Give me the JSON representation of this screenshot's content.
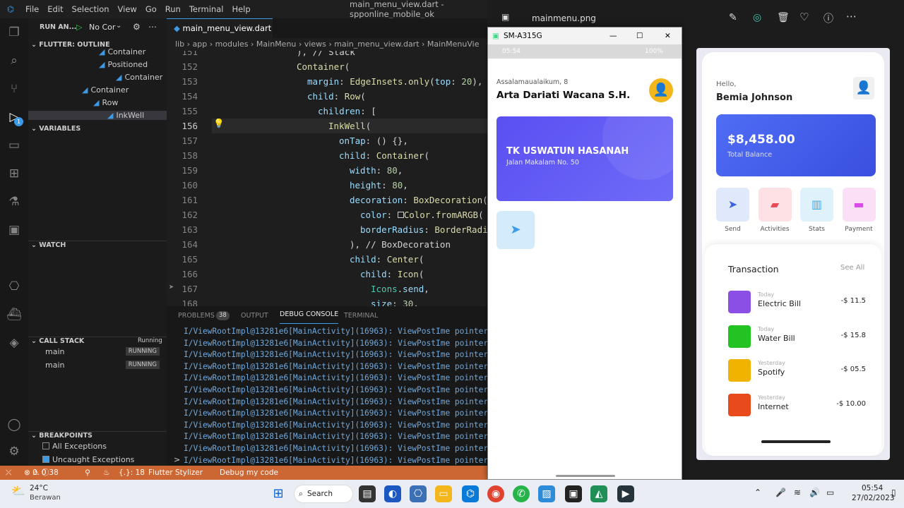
{
  "titlebar": {
    "menus": [
      "File",
      "Edit",
      "Selection",
      "View",
      "Go",
      "Run",
      "Terminal",
      "Help"
    ],
    "window_title": "main_menu_view.dart - spponline_mobile_ok"
  },
  "sidebar": {
    "run_label": "RUN AN...",
    "config": "No Cor",
    "outline_title": "FLUTTER: OUTLINE",
    "outline_items": [
      {
        "label": "Container"
      },
      {
        "label": "Positioned"
      },
      {
        "label": "Container"
      },
      {
        "label": "Container"
      },
      {
        "label": "Row"
      },
      {
        "label": "InkWell"
      }
    ],
    "variables_title": "VARIABLES",
    "watch_title": "WATCH",
    "callstack_title": "CALL STACK",
    "callstack_status": "Running",
    "threads": [
      {
        "name": "main",
        "status": "RUNNING"
      },
      {
        "name": "main",
        "status": "RUNNING"
      }
    ],
    "breakpoints_title": "BREAKPOINTS",
    "breakpoints": [
      {
        "label": "All Exceptions"
      },
      {
        "label": "Uncaught Exceptions"
      }
    ],
    "debug_badge": "1"
  },
  "editor": {
    "tab_label": "main_menu_view.dart",
    "breadcrumb": "lib › app › modules › MainMenu › views › main_menu_view.dart › MainMenuVie",
    "line_numbers": [
      "151",
      "152",
      "153",
      "154",
      "155",
      "156",
      "157",
      "158",
      "159",
      "160",
      "161",
      "162",
      "163",
      "164",
      "165",
      "166",
      "167",
      "168"
    ]
  },
  "panel": {
    "tabs": {
      "problems": "PROBLEMS",
      "problems_count": "38",
      "output": "OUTPUT",
      "debug": "DEBUG CONSOLE",
      "terminal": "TERMINAL"
    },
    "lines": [
      "I/ViewRootImpl@13281e6[MainActivity](16963): ViewPostIme pointer 1",
      "I/ViewRootImpl@13281e6[MainActivity](16963): ViewPostIme pointer 0",
      "I/ViewRootImpl@13281e6[MainActivity](16963): ViewPostIme pointer 1",
      "I/ViewRootImpl@13281e6[MainActivity](16963): ViewPostIme pointer 0",
      "I/ViewRootImpl@13281e6[MainActivity](16963): ViewPostIme pointer 1",
      "I/ViewRootImpl@13281e6[MainActivity](16963): ViewPostIme pointer 0",
      "I/ViewRootImpl@13281e6[MainActivity](16963): ViewPostIme pointer 1",
      "I/ViewRootImpl@13281e6[MainActivity](16963): ViewPostIme pointer 0",
      "I/ViewRootImpl@13281e6[MainActivity](16963): ViewPostIme pointer 1",
      "I/ViewRootImpl@13281e6[MainActivity](16963): ViewPostIme pointer 0",
      "I/ViewRootImpl@13281e6[MainActivity](16963): ViewPostIme pointer 1",
      "I/ViewRootImpl@13281e6[MainActivity](16963): ViewPostIme pointer 0"
    ],
    "prompt": ">"
  },
  "statusbar": {
    "errors": "0",
    "warnings": "0",
    "problems": "38",
    "lines": "{.}: 18",
    "stylizer": "Flutter Stylizer",
    "debug": "Debug my code"
  },
  "viewer": {
    "file": "mainmenu.png"
  },
  "emulator": {
    "device": "SM-A315G",
    "time": "05:54",
    "battery": "100%",
    "greeting": "Assalamaualaikum, 8",
    "name": "Arta Dariati Wacana S.H.",
    "card_title": "TK USWATUN HASANAH",
    "card_address": "Jalan Makalam No. 50"
  },
  "mockup": {
    "hello": "Hello,",
    "name": "Bemia Johnson",
    "balance": "$8,458.00",
    "balance_label": "Total Balance",
    "actions": [
      {
        "label": "Send"
      },
      {
        "label": "Activities"
      },
      {
        "label": "Stats"
      },
      {
        "label": "Payment"
      }
    ],
    "transaction_title": "Transaction",
    "see_all": "See All",
    "transactions": [
      {
        "when": "Today",
        "name": "Electric Bill",
        "amount": "-$ 11.5",
        "color": "#8b4fe6"
      },
      {
        "when": "Today",
        "name": "Water Bill",
        "amount": "-$ 15.8",
        "color": "#22c322"
      },
      {
        "when": "Yesterday",
        "name": "Spotify",
        "amount": "-$ 05.5",
        "color": "#f0b400"
      },
      {
        "when": "Yesterday",
        "name": "Internet",
        "amount": "-$ 10.00",
        "color": "#e84a1e"
      }
    ]
  },
  "taskbar": {
    "temp": "24°C",
    "weather": "Berawan",
    "search": "Search",
    "time": "05:54",
    "date": "27/02/2023"
  }
}
